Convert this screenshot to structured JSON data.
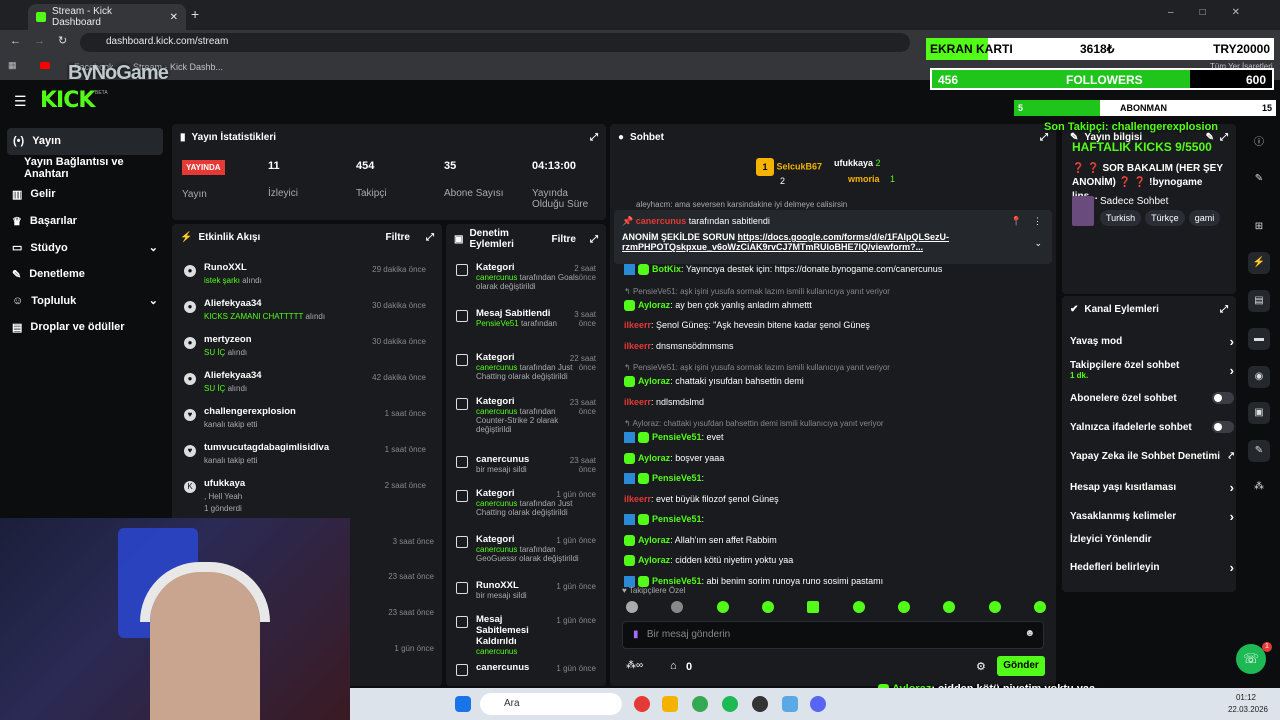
{
  "browser": {
    "tab_title": "Stream - Kick Dashboard",
    "new_tab": "+",
    "url": "dashboard.kick.com/stream",
    "bookmarks": [
      "Facebook",
      "Stream - Kick Dashb..."
    ],
    "all_bookmarks": "Tüm Yer İşaretleri"
  },
  "overlay": {
    "logo_text": "ByNoGame",
    "gpu_label": "EKRAN KARTI",
    "gpu_price": "3618₺",
    "gpu_goal": "TRY20000",
    "followers_count": "456",
    "followers_label": "FOLLOWERS",
    "followers_goal": "600",
    "followers_progress": 0.76,
    "subs_count": "5",
    "subs_label": "ABONMAN",
    "subs_goal": "15",
    "subs_progress": 0.33,
    "last_follower": "Son Takipçi: challengerexplosion",
    "webcam_caption_user": "Ayloraz",
    "webcam_caption_text": ": cidden kötü niyetim yoktu yaa"
  },
  "kick": {
    "logo": "KICK",
    "beta": "BETA"
  },
  "sidebar": {
    "items": [
      {
        "label": "Yayın",
        "icon": "broadcast-icon"
      },
      {
        "label": "Yayın Bağlantısı ve Anahtarı",
        "icon": ""
      },
      {
        "label": "Gelir",
        "icon": "revenue-icon"
      },
      {
        "label": "Başarılar",
        "icon": "trophy-icon"
      },
      {
        "label": "Stüdyo",
        "icon": "studio-icon"
      },
      {
        "label": "Denetleme",
        "icon": "wrench-icon"
      },
      {
        "label": "Topluluk",
        "icon": "community-icon"
      },
      {
        "label": "Droplar ve ödüller",
        "icon": "drops-icon"
      }
    ]
  },
  "stats": {
    "title": "Yayın İstatistikleri",
    "live_badge": "YAYINDA",
    "items": [
      {
        "value": "",
        "label": "Yayın"
      },
      {
        "value": "11",
        "label": "İzleyici"
      },
      {
        "value": "454",
        "label": "Takipçi"
      },
      {
        "value": "35",
        "label": "Abone Sayısı"
      },
      {
        "value": "04:13:00",
        "label": "Yayında Olduğu Süre"
      }
    ]
  },
  "activity": {
    "title": "Etkinlik Akışı",
    "filter": "Filtre",
    "events": [
      {
        "name": "RunoXXL",
        "sub": "istek şarkı",
        "sub2": "alındı",
        "time": "29 dakika önce"
      },
      {
        "name": "Aliefekyaa34",
        "sub": "KICKS ZAMANI CHATTTTT",
        "sub2": "alındı",
        "time": "30 dakika önce"
      },
      {
        "name": "mertyzeon",
        "sub": "SU İÇ",
        "sub2": "alındı",
        "time": "30 dakika önce"
      },
      {
        "name": "Aliefekyaa34",
        "sub": "SU İÇ",
        "sub2": "alındı",
        "time": "42 dakika önce"
      },
      {
        "name": "challengerexplosion",
        "sub": "",
        "sub2": "kanalı takip etti",
        "time": "1 saat önce"
      },
      {
        "name": "tumvucutagdabagimlisidiva",
        "sub": "",
        "sub2": "kanalı takip etti",
        "time": "1 saat önce"
      },
      {
        "name": "ufukkaya",
        "sub": ", Hell Yeah",
        "sub2": "1 gönderdi",
        "time": "2 saat önce"
      }
    ],
    "extra_times": [
      "3 saat önce",
      "23 saat önce",
      "23 saat önce",
      "1 gün önce"
    ]
  },
  "moderation": {
    "title": "Denetim Eylemleri",
    "filter": "Filtre",
    "items": [
      {
        "name": "Kategori",
        "user": "canercunus",
        "desc": "tarafından Goals olarak değiştirildi",
        "time": "2 saat önce"
      },
      {
        "name": "Mesaj Sabitlendi",
        "user": "PensieVe51",
        "desc": "tarafından",
        "time": "3 saat önce"
      },
      {
        "name": "Kategori",
        "user": "canercunus",
        "desc": "tarafından Just Chatting olarak değiştirildi",
        "time": "22 saat önce"
      },
      {
        "name": "Kategori",
        "user": "canercunus",
        "desc": "tarafından Counter-Strike 2 olarak değiştirildi",
        "time": "23 saat önce"
      },
      {
        "name": "canercunus",
        "user": "",
        "desc": "bir mesajı sildi",
        "time": "23 saat önce"
      },
      {
        "name": "Kategori",
        "user": "canercunus",
        "desc": "tarafından Just Chatting olarak değiştirildi",
        "time": "1 gün önce"
      },
      {
        "name": "Kategori",
        "user": "canercunus",
        "desc": "tarafından GeoGuessr olarak değiştirildi",
        "time": "1 gün önce"
      },
      {
        "name": "RunoXXL",
        "user": "",
        "desc": "bir mesajı sildi",
        "time": "1 gün önce"
      },
      {
        "name": "Mesaj Sabitlemesi Kaldırıldı",
        "user": "canercunus",
        "desc": "",
        "time": "1 gün önce"
      },
      {
        "name": "canercunus",
        "user": "",
        "desc": "",
        "time": "1 gün önce"
      }
    ]
  },
  "chat": {
    "title": "Sohbet",
    "top": [
      {
        "rank": "1",
        "name": "SelcukB67",
        "count": "2"
      },
      {
        "rank": "",
        "name": "ufukkaya",
        "count": "2"
      },
      {
        "rank": "",
        "name": "wmoria",
        "count": "1"
      }
    ],
    "partial_line": "aleyhacm: ama seversen karsindakine iyi delmeye calisirsin",
    "pinned_by": "canercunus",
    "pinned_suffix": "tarafından sabitlendi",
    "pinned_text": "ANONİM ŞEKİLDE SORUN",
    "pinned_link1": "https://docs.google.com/forms/d/e/1FAIpQLSezU-",
    "pinned_link2": "rzmPHPOTQskpxue_v6oWzCiAK9rvCJ7MTmRUloBHE7lQ/viewform?...",
    "lines": [
      {
        "type": "msg",
        "user": "BotKix",
        "ucolor": "#53fc18",
        "text": ": Yayıncıya destek için: https://donate.bynogame.com/canercunus"
      },
      {
        "type": "reply",
        "text": "PensieVe51: aşk işini yusufa sormak lazım ismili kullanıcıya yanıt veriyor"
      },
      {
        "type": "msg",
        "user": "Ayloraz",
        "ucolor": "#53fc18",
        "text": ": ay ben çok yanlış anladım ahmettt"
      },
      {
        "type": "msg",
        "user": "ilkeerr",
        "ucolor": "#e53935",
        "text": ": Şenol Güneş: \"Aşk hevesin bitene kadar şenol Güneş"
      },
      {
        "type": "msg",
        "user": "ilkeerr",
        "ucolor": "#e53935",
        "text": ": dnsmsnsödmmsms"
      },
      {
        "type": "reply",
        "text": "PensieVe51: aşk işini yusufa sormak lazım ismili kullanıcıya yanıt veriyor"
      },
      {
        "type": "msg",
        "user": "Ayloraz",
        "ucolor": "#53fc18",
        "text": ": chattaki yısufdan bahsettin demi"
      },
      {
        "type": "msg",
        "user": "ilkeerr",
        "ucolor": "#e53935",
        "text": ": ndlsmdslmd"
      },
      {
        "type": "reply",
        "text": "Ayloraz: chattaki yısufdan bahsettin demi ismili kullanıcıya yanıt veriyor"
      },
      {
        "type": "msg",
        "user": "PensieVe51",
        "ucolor": "#53fc18",
        "text": ": evet"
      },
      {
        "type": "msg",
        "user": "Ayloraz",
        "ucolor": "#53fc18",
        "text": ": boşver yaaa"
      },
      {
        "type": "msg",
        "user": "PensieVe51",
        "ucolor": "#53fc18",
        "text": ":"
      },
      {
        "type": "msg",
        "user": "ilkeerr",
        "ucolor": "#e53935",
        "text": ": evet büyük filozof şenol Güneş"
      },
      {
        "type": "msg",
        "user": "PensieVe51",
        "ucolor": "#53fc18",
        "text": ":"
      },
      {
        "type": "msg",
        "user": "Ayloraz",
        "ucolor": "#53fc18",
        "text": ": Allah'ım sen affet Rabbim"
      },
      {
        "type": "msg",
        "user": "Ayloraz",
        "ucolor": "#53fc18",
        "text": ": cidden kötü niyetim yoktu yaa"
      },
      {
        "type": "msg",
        "user": "PensieVe51",
        "ucolor": "#53fc18",
        "text": ": abi benim sorim runoya runo sosimi pastamı"
      }
    ],
    "followers_only": "Takipçilere Özel",
    "input_placeholder": "Bir mesaj gönderin",
    "points": "0",
    "send": "Gönder"
  },
  "stream_info": {
    "title": "Yayın bilgisi",
    "line1": "HAFTALIK KICKS 9/5500",
    "line2": "❓ ❓ SOR BAKALIM (HER ŞEY ANONİM) ❓ ❓ !bynogame lins...",
    "category": "Sadece Sohbet",
    "tags": [
      "Turkish",
      "Türkçe",
      "gami"
    ]
  },
  "channel_actions": {
    "title": "Kanal Eylemleri",
    "items": [
      {
        "label": "Yavaş mod",
        "sub": "",
        "control": "chevron"
      },
      {
        "label": "Takipçilere özel sohbet",
        "sub": "1 dk.",
        "control": "chevron"
      },
      {
        "label": "Abonelere özel sohbet",
        "sub": "",
        "control": "toggle"
      },
      {
        "label": "Yalnızca ifadelerle sohbet",
        "sub": "",
        "control": "toggle"
      },
      {
        "label": "Yapay Zeka ile Sohbet Denetimi",
        "sub": "",
        "control": "external"
      },
      {
        "label": "Hesap yaşı kısıtlaması",
        "sub": "",
        "control": "chevron"
      },
      {
        "label": "Yasaklanmış kelimeler",
        "sub": "",
        "control": "chevron"
      },
      {
        "label": "İzleyici Yönlendir",
        "sub": "",
        "control": ""
      },
      {
        "label": "Hedefleri belirleyin",
        "sub": "",
        "control": "chevron"
      }
    ]
  },
  "fab_badge": "1",
  "taskbar": {
    "search": "Ara",
    "time": "01:12",
    "date": "22.03.2026"
  }
}
